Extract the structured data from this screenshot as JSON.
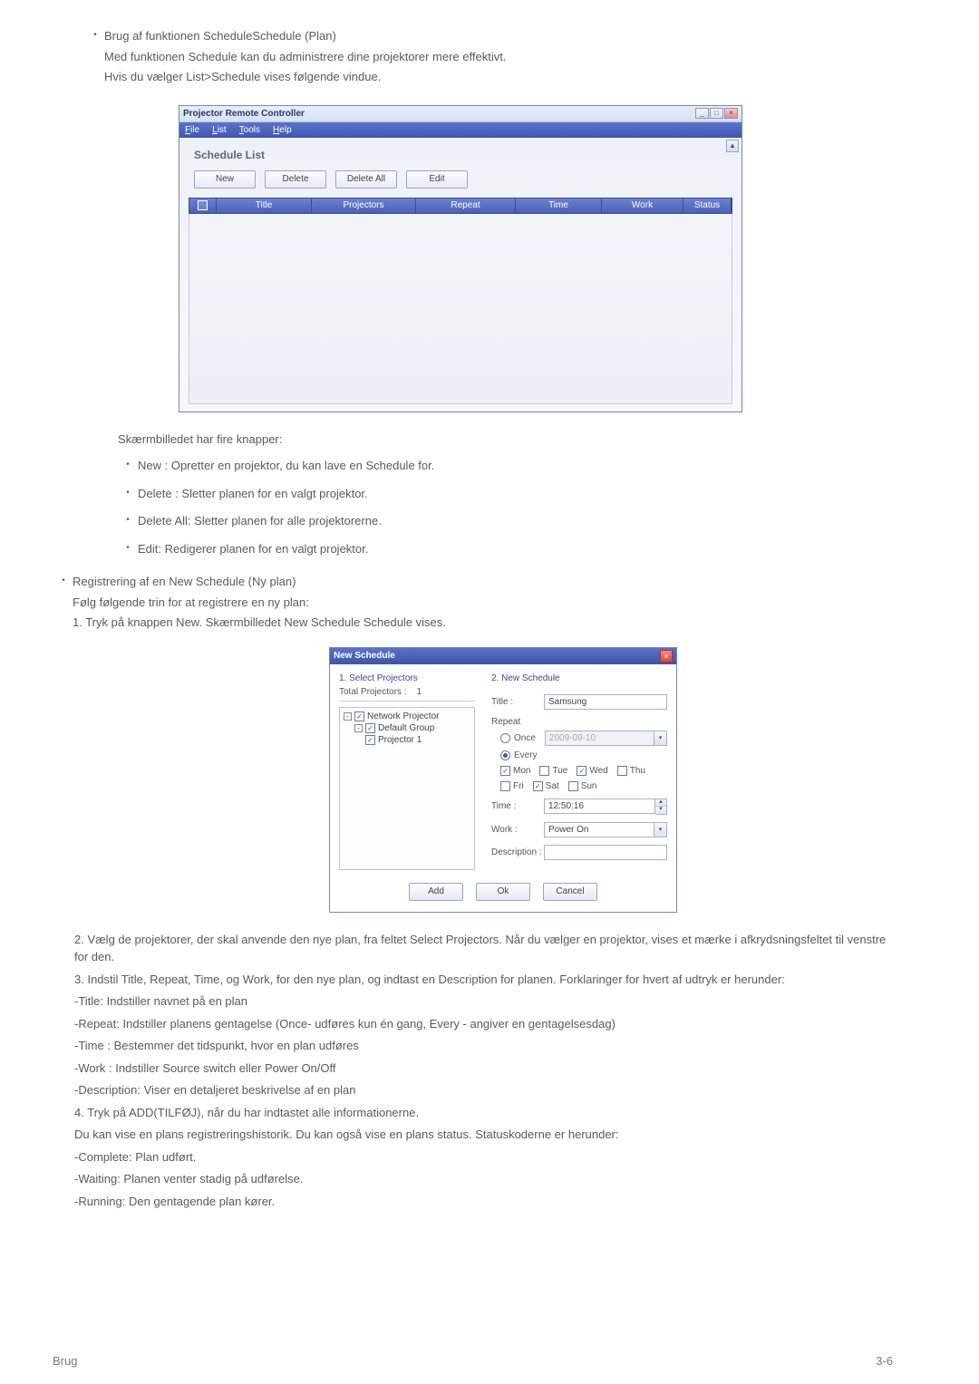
{
  "section1": {
    "title": "Brug af funktionen ScheduleSchedule (Plan)",
    "line1": "Med funktionen Schedule kan du administrere dine projektorer mere effektivt.",
    "line2": "Hvis du vælger  List>Schedule vises følgende vindue."
  },
  "win1": {
    "title": "Projector Remote Controller",
    "menu": {
      "file": "File",
      "list": "List",
      "tools": "Tools",
      "help": "Help"
    },
    "heading": "Schedule List",
    "buttons": {
      "new": "New",
      "delete": "Delete",
      "deleteAll": "Delete All",
      "edit": "Edit"
    },
    "cols": {
      "title": "Title",
      "projectors": "Projectors",
      "repeat": "Repeat",
      "time": "Time",
      "work": "Work",
      "status": "Status"
    }
  },
  "afterWin1": {
    "intro": "Skærmbilledet har fire knapper:",
    "items": [
      " New : Opretter en projektor, du kan lave en Schedule for.",
      "Delete : Sletter planen for en valgt projektor.",
      "Delete All: Sletter planen for alle projektorerne.",
      "Edit: Redigerer planen for en valgt projektor."
    ]
  },
  "section2": {
    "title": "Registrering af en New Schedule (Ny plan)",
    "line1": "Følg følgende trin for at registrere en ny plan:",
    "line2": "1. Tryk på knappen New. Skærmbilledet  New Schedule Schedule vises."
  },
  "dlg2": {
    "title": "New Schedule",
    "leftHeader": "1. Select Projectors",
    "totalLabel": "Total Projectors :",
    "totalValue": "1",
    "tree": {
      "n1": "Network Projector",
      "n2": "Default Group",
      "n3": "Projector 1"
    },
    "rightHeader": "2. New Schedule",
    "labels": {
      "title": "Title :",
      "repeat": "Repeat",
      "once": "Once",
      "every": "Every",
      "time": "Time :",
      "work": "Work :",
      "desc": "Description :"
    },
    "values": {
      "title": "Samsung",
      "date": "2009-09-10",
      "time": "12:50:16",
      "work": "Power On"
    },
    "days": {
      "mon": "Mon",
      "tue": "Tue",
      "wed": "Wed",
      "thu": "Thu",
      "fri": "Fri",
      "sat": "Sat",
      "sun": "Sun"
    },
    "buttons": {
      "add": "Add",
      "ok": "Ok",
      "cancel": "Cancel"
    }
  },
  "bottom": {
    "p2": "2. Vælg de projektorer, der skal anvende den nye plan, fra feltet Select Projectors. Når du vælger en projektor, vises et mærke i afkrydsningsfeltet til venstre for den.",
    "p3": "3. Indstil Title, Repeat, Time, og Work, for den nye plan, og indtast en Description for planen. Forklaringer for hvert af udtryk er herunder:",
    "l1": "-Title: Indstiller navnet på en plan",
    "l2": "-Repeat: Indstiller planens gentagelse (Once- udføres kun én gang, Every - angiver en gentagelsesdag)",
    "l3": "-Time : Bestemmer det tidspunkt, hvor en plan udføres",
    "l4": "-Work : Indstiller Source switch eller Power On/Off",
    "l5": "-Description: Viser en detaljeret beskrivelse af en plan",
    "p4": "4. Tryk på ADD(TILFØJ), når du har indtastet alle informationerne.",
    "p5": "Du kan vise en plans registreringshistorik. Du kan også vise en plans status. Statuskoderne er herunder:",
    "s1": "-Complete: Plan udført.",
    "s2": "-Waiting: Planen venter stadig på udførelse.",
    "s3": "-Running: Den gentagende plan kører."
  },
  "footer": {
    "left": "Brug",
    "right": "3-6"
  }
}
